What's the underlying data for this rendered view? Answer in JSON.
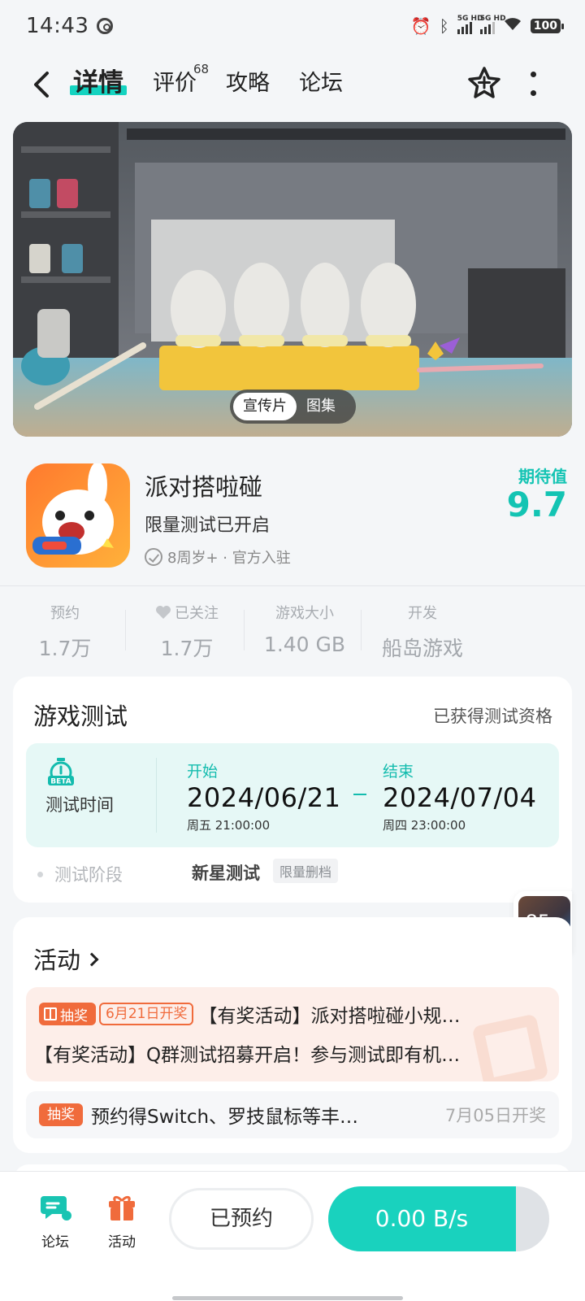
{
  "status_bar": {
    "time": "14:43",
    "sim1": "5G HD",
    "sim2": "5G HD",
    "battery": "100"
  },
  "nav": {
    "tabs": [
      {
        "label": "详情",
        "active": true
      },
      {
        "label": "评价",
        "badge": "68"
      },
      {
        "label": "攻略"
      },
      {
        "label": "论坛"
      }
    ]
  },
  "banner": {
    "options": [
      "宣传片",
      "图集"
    ],
    "selected": "宣传片"
  },
  "game": {
    "name": "派对搭啦碰",
    "status": "限量测试已开启",
    "meta": "8周岁+ · 官方入驻",
    "score_label": "期待值",
    "score": "9.7"
  },
  "stats": [
    {
      "label": "预约",
      "value": "1.7万"
    },
    {
      "label": "已关注",
      "value": "1.7万"
    },
    {
      "label": "游戏大小",
      "value": "1.40 GB"
    },
    {
      "label": "开发",
      "value": "船岛游戏"
    }
  ],
  "test": {
    "title": "游戏测试",
    "qualification": "已获得测试资格",
    "time_label": "测试时间",
    "start_label": "开始",
    "start_date": "2024/06/21",
    "start_sub": "周五  21:00:00",
    "end_label": "结束",
    "end_date": "2024/07/04",
    "end_sub": "周四  23:00:00",
    "stage_label": "测试阶段",
    "stage_value": "新星测试",
    "stage_tag": "限量删档"
  },
  "float_progress": {
    "percent": 85,
    "text": "85",
    "unit": "%"
  },
  "activity": {
    "title": "活动",
    "featured": {
      "badge": "抽奖",
      "date_tag": "6月21日开奖",
      "line1": "【有奖活动】派对搭啦碰小规…",
      "line2": "【有奖活动】Q群测试招募开启！参与测试即有机…"
    },
    "item": {
      "badge": "抽奖",
      "text": "预约得Switch、罗技鼠标等丰…",
      "open_date": "7月05日开奖"
    }
  },
  "bottom": {
    "forum": "论坛",
    "activity": "活动",
    "reserved": "已预约",
    "download_speed": "0.00 B/s",
    "download_progress": 0.85
  },
  "colors": {
    "accent": "#19d2be",
    "orange": "#f06b3c"
  }
}
